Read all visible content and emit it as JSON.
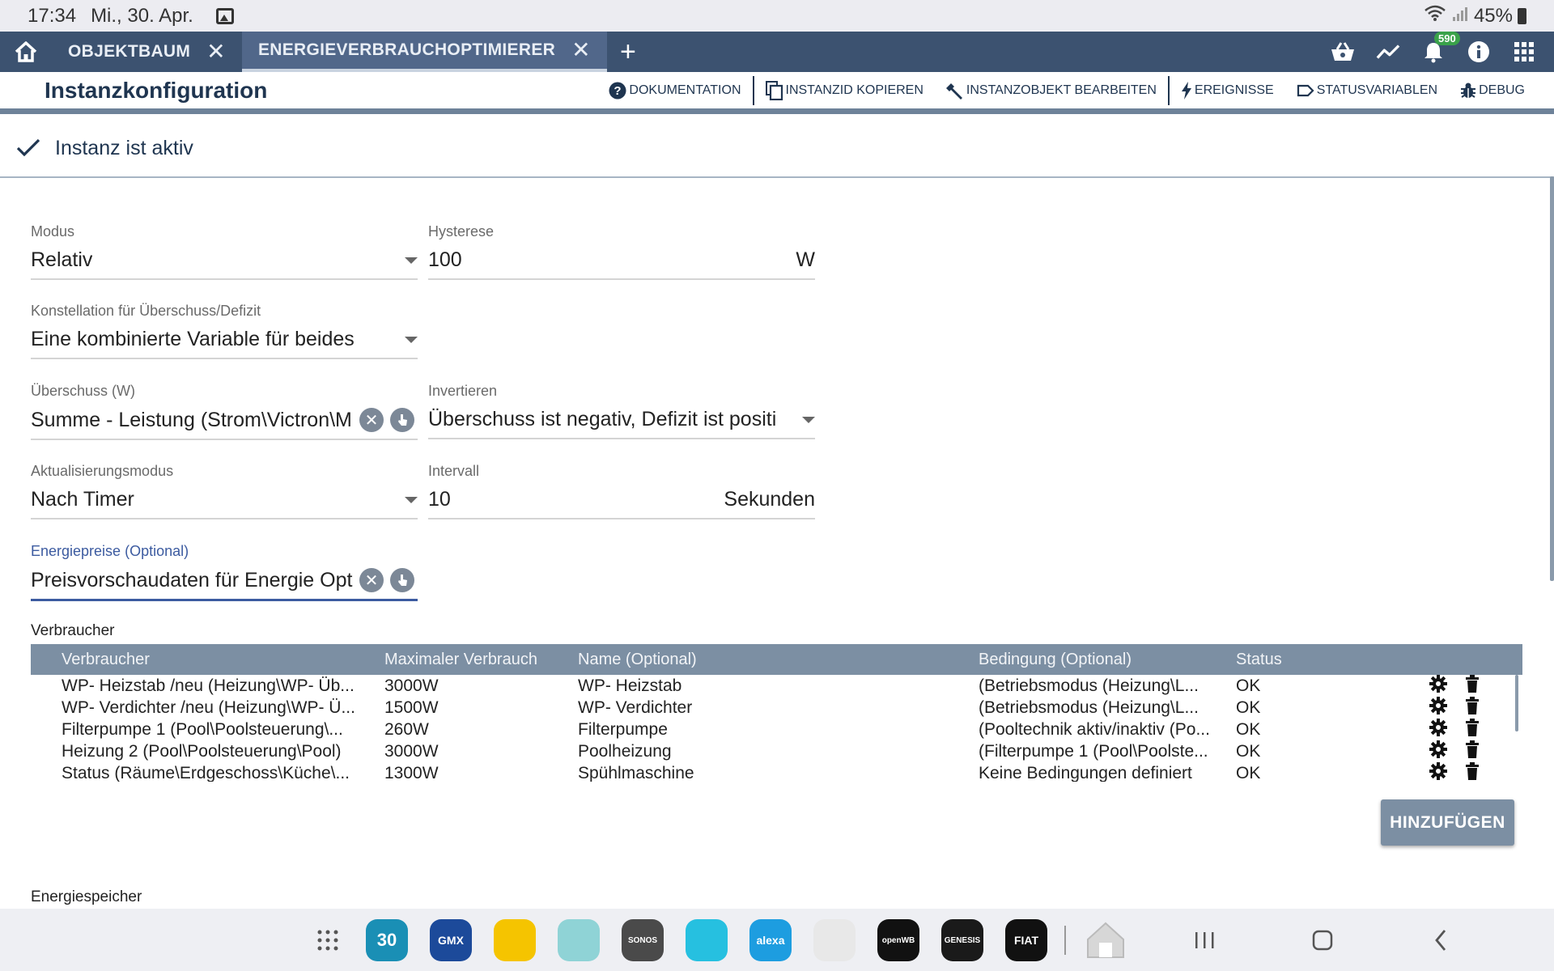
{
  "status_bar": {
    "time": "17:34",
    "date": "Mi., 30. Apr.",
    "battery": "45%",
    "icons": [
      "image-icon",
      "wifi-icon",
      "signal-icon",
      "battery-icon"
    ]
  },
  "tabs": [
    {
      "label": "OBJEKTBAUM",
      "active": false
    },
    {
      "label": "ENERGIEVERBRAUCHOPTIMIERER",
      "active": true
    }
  ],
  "topbar": {
    "notification_count": "590",
    "icons": [
      "basket-icon",
      "chart-icon",
      "bell-icon",
      "info-icon",
      "apps-grid-icon"
    ]
  },
  "header": {
    "title": "Instanzkonfiguration",
    "actions": {
      "documentation": "DOKUMENTATION",
      "copy_id": "INSTANZID KOPIEREN",
      "edit_object": "INSTANZOBJEKT BEARBEITEN",
      "events": "EREIGNISSE",
      "status_vars": "STATUSVARIABLEN",
      "debug": "DEBUG"
    }
  },
  "instance_active": "Instanz ist aktiv",
  "form": {
    "mode": {
      "label": "Modus",
      "value": "Relativ"
    },
    "hysteresis": {
      "label": "Hysterese",
      "value": "100",
      "unit": "W"
    },
    "constellation": {
      "label": "Konstellation für Überschuss/Defizit",
      "value": "Eine kombinierte Variable für beides"
    },
    "surplus": {
      "label": "Überschuss (W)",
      "value": "Summe - Leistung (Strom\\Victron\\M"
    },
    "invert": {
      "label": "Invertieren",
      "value": "Überschuss ist negativ, Defizit ist positi"
    },
    "update_mode": {
      "label": "Aktualisierungsmodus",
      "value": "Nach Timer"
    },
    "interval": {
      "label": "Intervall",
      "value": "10",
      "unit": "Sekunden"
    },
    "energy_prices": {
      "label": "Energiepreise (Optional)",
      "value": "Preisvorschaudaten für Energie Opt"
    }
  },
  "consumers": {
    "section_label": "Verbraucher",
    "columns": [
      "Verbraucher",
      "Maximaler Verbrauch",
      "Name (Optional)",
      "Bedingung (Optional)",
      "Status"
    ],
    "rows": [
      [
        "WP- Heizstab /neu (Heizung\\WP- Üb...",
        "3000W",
        "WP- Heizstab",
        "(Betriebsmodus (Heizung\\L...",
        "OK"
      ],
      [
        "WP- Verdichter /neu (Heizung\\WP- Ü...",
        "1500W",
        "WP- Verdichter",
        "(Betriebsmodus (Heizung\\L...",
        "OK"
      ],
      [
        "Filterpumpe 1 (Pool\\Poolsteuerung\\...",
        "260W",
        "Filterpumpe",
        "(Pooltechnik aktiv/inaktiv (Po...",
        "OK"
      ],
      [
        "Heizung 2 (Pool\\Poolsteuerung\\Pool)",
        "3000W",
        "Poolheizung",
        "(Filterpumpe 1 (Pool\\Poolste...",
        "OK"
      ],
      [
        "Status (Räume\\Erdgeschoss\\Küche\\...",
        "1300W",
        "Spühlmaschine",
        "Keine Bedingungen definiert",
        "OK"
      ]
    ],
    "add_button": "HINZUFÜGEN"
  },
  "storage": {
    "section_label": "Energiespeicher"
  },
  "dock": {
    "apps": [
      {
        "name": "calendar-app",
        "label": "30",
        "color": "#1a8fb5"
      },
      {
        "name": "gmx-app",
        "label": "GMX",
        "color": "#1c4a9a"
      },
      {
        "name": "bank-app",
        "label": "",
        "color": "#f5c400"
      },
      {
        "name": "bubbles-app",
        "label": "",
        "color": "#8fd3d6"
      },
      {
        "name": "sonos-app",
        "label": "SONOS",
        "color": "#4a4a4a"
      },
      {
        "name": "flash-app",
        "label": "",
        "color": "#26c0e0"
      },
      {
        "name": "alexa-app",
        "label": "alexa",
        "color": "#1d9de0"
      },
      {
        "name": "home-app",
        "label": "",
        "color": "#e8e8e8"
      },
      {
        "name": "openwb-app",
        "label": "openWB",
        "color": "#111111"
      },
      {
        "name": "genesis-app",
        "label": "GENESIS",
        "color": "#1a1a1a"
      },
      {
        "name": "fiat-app",
        "label": "FIAT",
        "color": "#111111"
      }
    ]
  }
}
